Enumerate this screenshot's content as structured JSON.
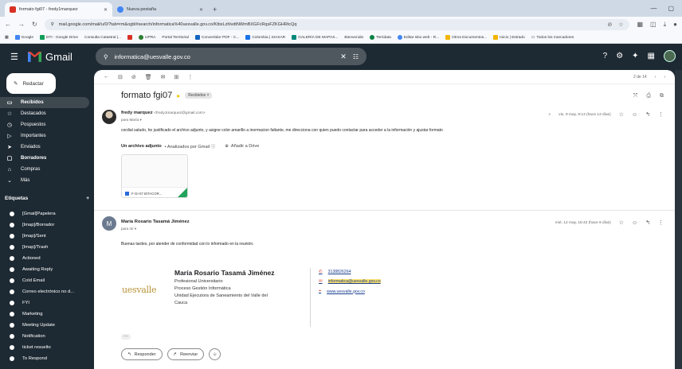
{
  "browser": {
    "tabs": [
      {
        "label": "formato fgi07 - fredy1marquez",
        "active": true,
        "color": "#d93025"
      },
      {
        "label": "Nueva pestaña",
        "active": false,
        "color": "#4285f4"
      }
    ],
    "new_tab": "+",
    "url": "mail.google.com/mail/u/0/?tab=rm&ogbl#search/informatica%40uesvalle.gov.co/KtbxLzhlvdtNWmBXGFcRqsFZKGHRtcQq",
    "bookmarks": [
      "Google",
      "DTI - Google Drive",
      "Consulta Catastral |...",
      "UPRA",
      "Portal Territorial",
      "Convertidor PDF - C...",
      "Colombia | SIASAR",
      "GALERÍA DE MAPAS...",
      "Bienvenido",
      "Terridata",
      "Editar sitio web - R...",
      "Otros Documentos...",
      "Inicio | Estrado",
      "Todos los marcadores"
    ]
  },
  "gmail": {
    "app_name": "Gmail",
    "search_value": "informatica@uesvalle.gov.co",
    "compose_label": "Redactar",
    "nav": [
      {
        "label": "Recibidos",
        "icon": "▭",
        "active": true
      },
      {
        "label": "Destacados",
        "icon": "☆"
      },
      {
        "label": "Pospuestos",
        "icon": "◷"
      },
      {
        "label": "Importantes",
        "icon": "▷"
      },
      {
        "label": "Enviados",
        "icon": "➤"
      },
      {
        "label": "Borradores",
        "icon": "▢"
      },
      {
        "label": "Compras",
        "icon": "⌂"
      },
      {
        "label": "Más",
        "icon": "⌄"
      }
    ],
    "labels_title": "Etiquetas",
    "labels_add": "+",
    "labels": [
      "[Gmail]Papelera",
      "[Imap]/Borrador",
      "[Imap]/Sent",
      "[Imap]/Trash",
      "Actioned",
      "Awaiting Reply",
      "Cold Email",
      "Correo electrónico no d...",
      "FYI",
      "Marketing",
      "Meeting Update",
      "Notification",
      "ticket resuelto",
      "To Respond"
    ]
  },
  "thread": {
    "pager": "2 de 14",
    "subject": "formato fgi07",
    "label_chip": "Recibidos ×",
    "messages": [
      {
        "sender": "fredy marquez",
        "email": "<fredy1marquez@gmail.com>",
        "to": "para María ▾",
        "date": "vie, 9 may, 9:13 (hace 13 días)",
        "body": "cordial saludo, he justificado el archivo adjunto, y asigne color amarillo a inormacion faltante, me direcciona con quien puedo contactar para acceder a la información y ajustar formato",
        "attach_title": "Un archivo adjunto",
        "attach_scan": "• Analizados por Gmail ⓘ",
        "attach_drive": "Añadir a Drive",
        "attach_name": "F-GI-07 BITACOR..."
      },
      {
        "sender": "María Rosario Tasamá Jiménez",
        "avatar_letter": "M",
        "to": "para mí ▾",
        "date": "mié, 12 may, 15:42 (hace 9 días)",
        "body": "Buenas tardes, por atender de conformidad con lo informado en la reunión.",
        "signature": {
          "logo_text": "uesvalle",
          "name": "María Rosario Tasamá Jiménez",
          "lines": [
            "Profesional Universitario",
            "Proceso Gestión Informática",
            "Unidad Ejecutora de Saneamiento del Valle del",
            "Cauca"
          ],
          "phone": "3138826264",
          "email": "informatica@uesvalle.gov.co",
          "web": "www.uesvalle.gov.co"
        }
      }
    ],
    "actions": {
      "reply": "Responder",
      "forward": "Reenviar"
    }
  }
}
